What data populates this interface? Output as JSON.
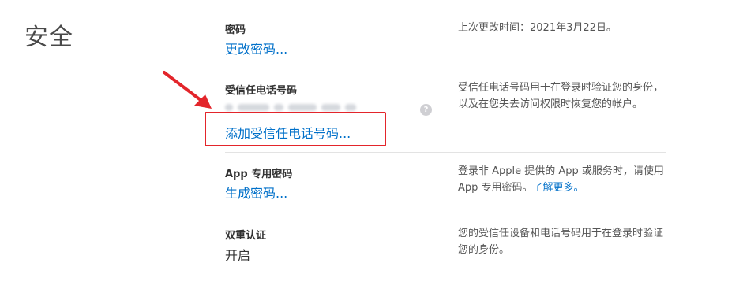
{
  "section": {
    "title": "安全"
  },
  "rows": [
    {
      "label": "密码",
      "link": "更改密码...",
      "description": "上次更改时间：2021年3月22日。"
    },
    {
      "label": "受信任电话号码",
      "link": "添加受信任电话号码...",
      "help_icon": "?",
      "description": "受信任电话号码用于在登录时验证您的身份，以及在您失去访问权限时恢复您的帐户。"
    },
    {
      "label": "App 专用密码",
      "link": "生成密码...",
      "description": "登录非 Apple 提供的 App 或服务时，请使用 App 专用密码。",
      "description_link": "了解更多。"
    },
    {
      "label": "双重认证",
      "value": "开启",
      "description": "您的受信任设备和电话号码用于在登录时验证您的身份。"
    }
  ],
  "colors": {
    "link": "#0070c9",
    "annotation": "#e3252b",
    "divider": "#e3e3e3"
  },
  "icons": {
    "help": "help-icon",
    "annotation_arrow": "arrow-icon"
  }
}
